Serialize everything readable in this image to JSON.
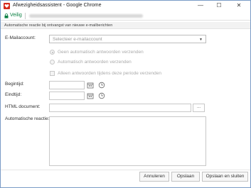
{
  "window": {
    "title": "Afwezigheidsassistent - Google Chrome",
    "min_glyph": "—",
    "max_glyph": "☐",
    "close_glyph": "✕"
  },
  "addressbar": {
    "secure_label": "Veilig"
  },
  "subtitle": "Automatische reactie bij ontvangst van nieuwe e-mailberichten",
  "form": {
    "email_label": "E-Mailaccount:",
    "email_select_placeholder": "Selecteer e-mailaccount",
    "radio_no_auto": "Geen automatisch antwoorden verzenden",
    "radio_auto": "Automatisch antwoorden verzenden",
    "checkbox_period": "Alleen antwoorden tijdens deze periode verzenden",
    "start_label": "Begintijd:",
    "end_label": "Eindtijd:",
    "html_label": "HTML document:",
    "more_label": "...",
    "auto_reply_label": "Automatische reactie:"
  },
  "buttons": {
    "cancel": "Annuleren",
    "save": "Opslaan",
    "save_close": "Opslaan en sluiten"
  },
  "colors": {
    "secure_green": "#0b8043",
    "app_icon_red": "#d52b1e"
  }
}
